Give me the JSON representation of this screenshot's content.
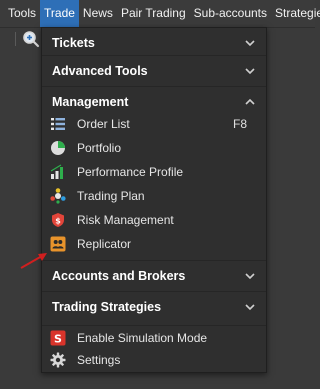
{
  "menubar": {
    "items": [
      "Tools",
      "Trade",
      "News",
      "Pair Trading",
      "Sub-accounts",
      "Strategies"
    ],
    "active": "Trade"
  },
  "dropdown": {
    "tickets": "Tickets",
    "advanced_tools": "Advanced Tools",
    "management": {
      "title": "Management",
      "items": [
        {
          "label": "Order List",
          "shortcut": "F8",
          "icon": "order-list-icon"
        },
        {
          "label": "Portfolio",
          "icon": "portfolio-icon"
        },
        {
          "label": "Performance Profile",
          "icon": "performance-icon"
        },
        {
          "label": "Trading Plan",
          "icon": "trading-plan-icon"
        },
        {
          "label": "Risk Management",
          "icon": "risk-icon"
        },
        {
          "label": "Replicator",
          "icon": "replicator-icon"
        }
      ]
    },
    "accounts_brokers": "Accounts and Brokers",
    "trading_strategies": "Trading Strategies",
    "bottom": [
      {
        "label": "Enable Simulation Mode",
        "icon": "simulation-icon"
      },
      {
        "label": "Settings",
        "icon": "settings-icon"
      }
    ]
  },
  "colors": {
    "active_menu": "#2e6fb7",
    "annotation_arrow": "#d01f1f"
  }
}
